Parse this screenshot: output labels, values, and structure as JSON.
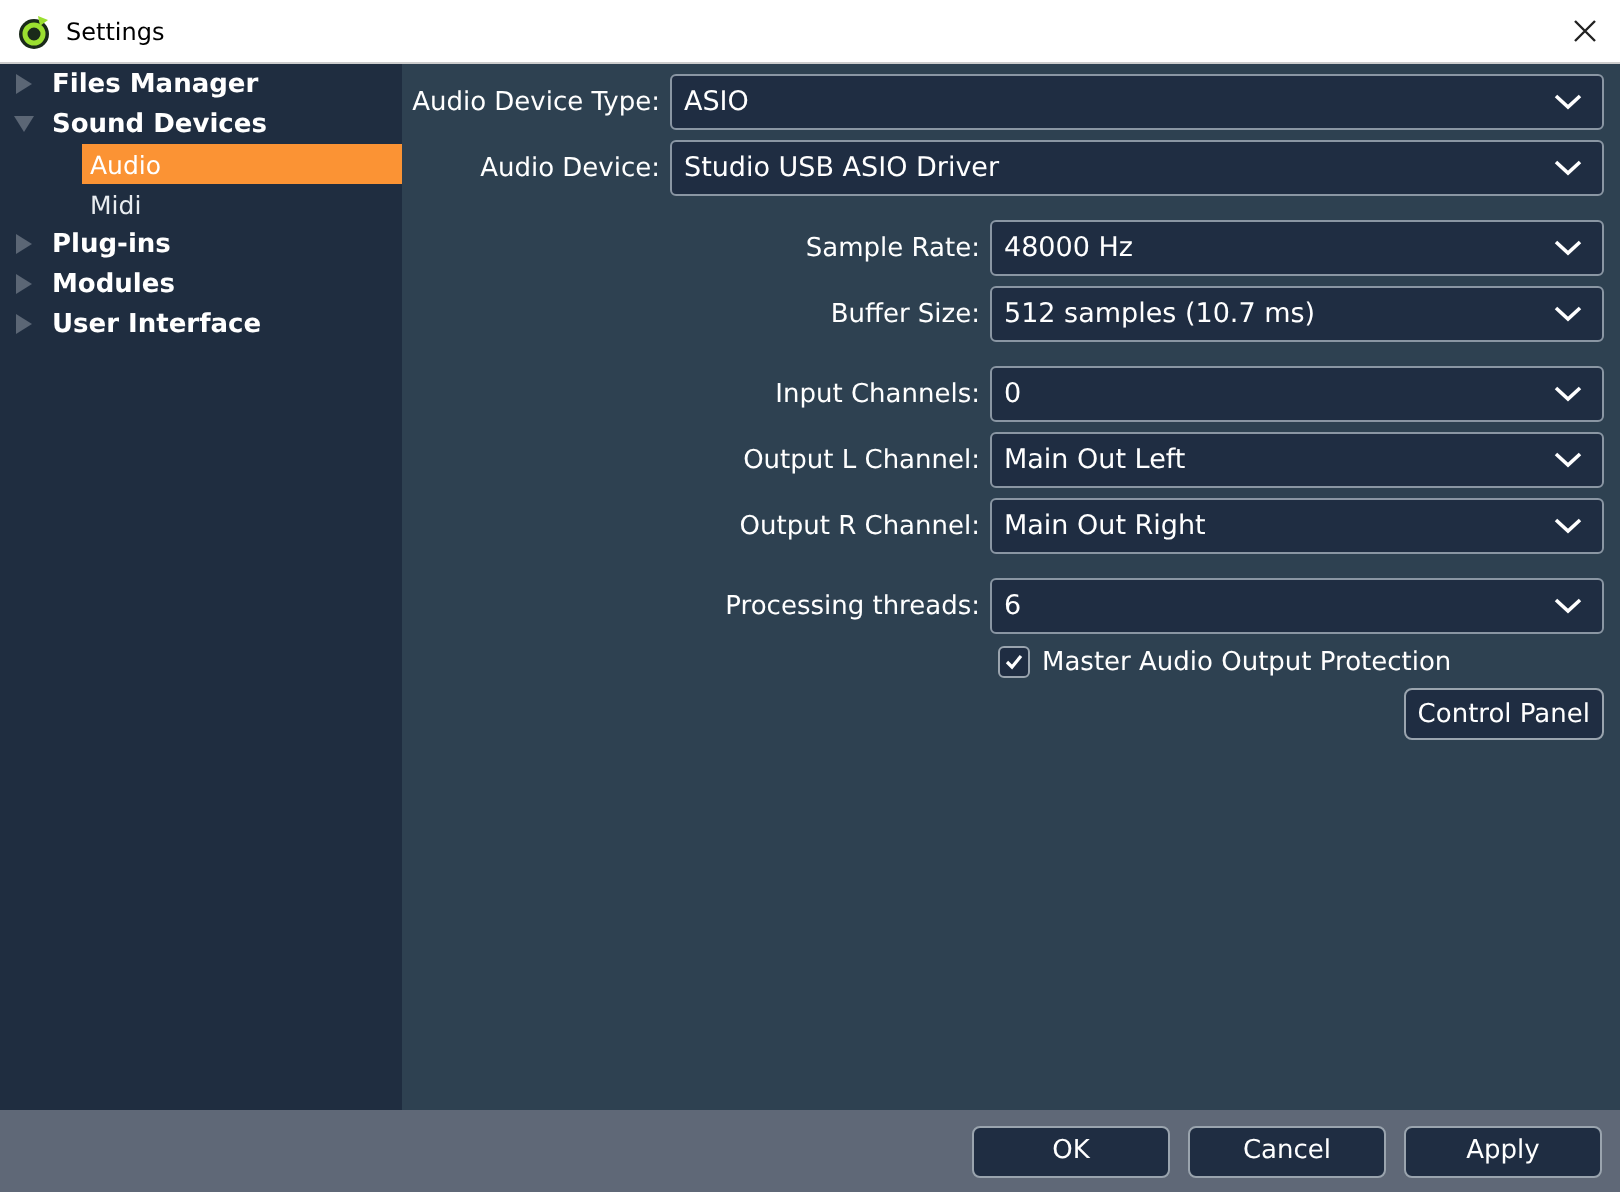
{
  "window": {
    "title": "Settings"
  },
  "sidebar": {
    "items": [
      {
        "label": "Files Manager",
        "expanded": false
      },
      {
        "label": "Sound Devices",
        "expanded": true,
        "children": [
          {
            "label": "Audio",
            "selected": true
          },
          {
            "label": "Midi",
            "selected": false
          }
        ]
      },
      {
        "label": "Plug-ins",
        "expanded": false
      },
      {
        "label": "Modules",
        "expanded": false
      },
      {
        "label": "User Interface",
        "expanded": false
      }
    ]
  },
  "groups": [
    {
      "fields": [
        {
          "label": "Audio Device Type:",
          "value": "ASIO"
        },
        {
          "label": "Audio Device:",
          "value": "Studio USB ASIO Driver"
        }
      ]
    },
    {
      "fields": [
        {
          "label": "Sample Rate:",
          "value": "48000 Hz"
        },
        {
          "label": "Buffer Size:",
          "value": "512 samples (10.7 ms)"
        }
      ]
    },
    {
      "fields": [
        {
          "label": "Input Channels:",
          "value": "0"
        },
        {
          "label": "Output L Channel:",
          "value": "Main Out Left"
        },
        {
          "label": "Output R Channel:",
          "value": "Main Out Right"
        }
      ]
    },
    {
      "fields": [
        {
          "label": "Processing threads:",
          "value": "6"
        }
      ]
    }
  ],
  "checkbox": {
    "label": "Master Audio Output Protection",
    "checked": true
  },
  "control_panel_button": "Control Panel",
  "buttons": [
    "OK",
    "Cancel",
    "Apply"
  ]
}
